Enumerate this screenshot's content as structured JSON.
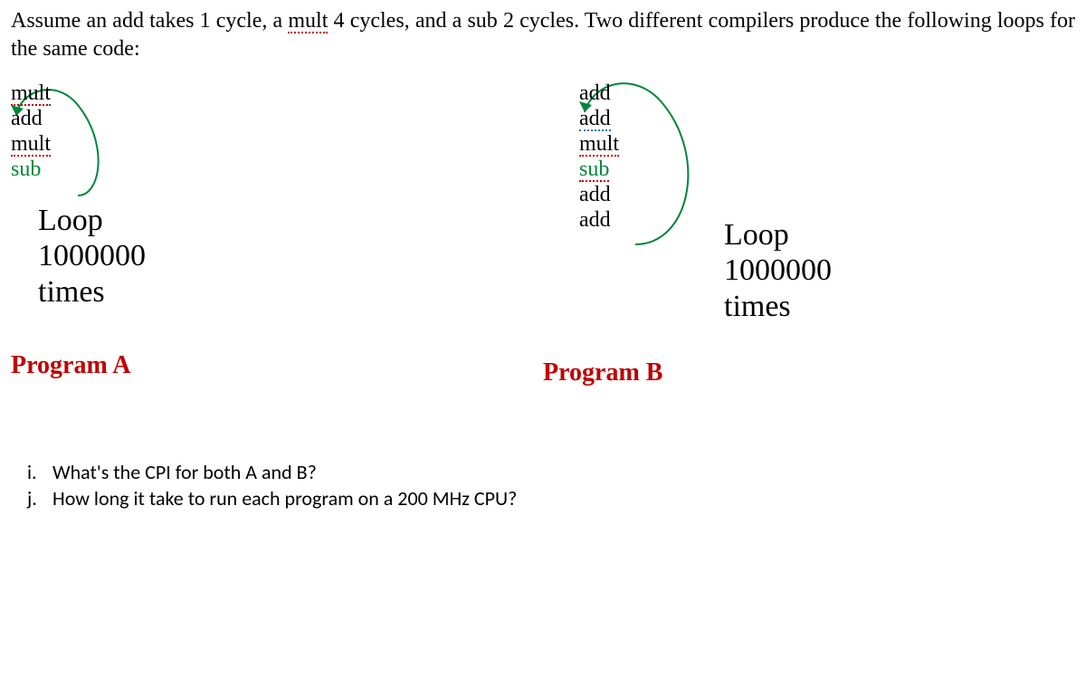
{
  "intro_pre": "Assume an add takes 1 cycle, a ",
  "intro_mult": "mult",
  "intro_mid": " 4 cycles, and a sub 2 cycles. Two different compilers produce the following loops for the same code:",
  "programA": {
    "instr": [
      "mult",
      "add",
      "mult",
      "sub"
    ],
    "loop1": "Loop",
    "loop2": "1000000",
    "loop3": "times",
    "label": "Program A"
  },
  "programB": {
    "instr": [
      "add",
      "add",
      "mult",
      "sub",
      "add",
      "add"
    ],
    "loop1": "Loop",
    "loop2": "1000000",
    "loop3": "times",
    "label": "Program B"
  },
  "q_i_num": "i.",
  "q_i": "What's the CPI for both A and B?",
  "q_j_num": "j.",
  "q_j": "How long it take to run each program on a 200 MHz CPU?"
}
